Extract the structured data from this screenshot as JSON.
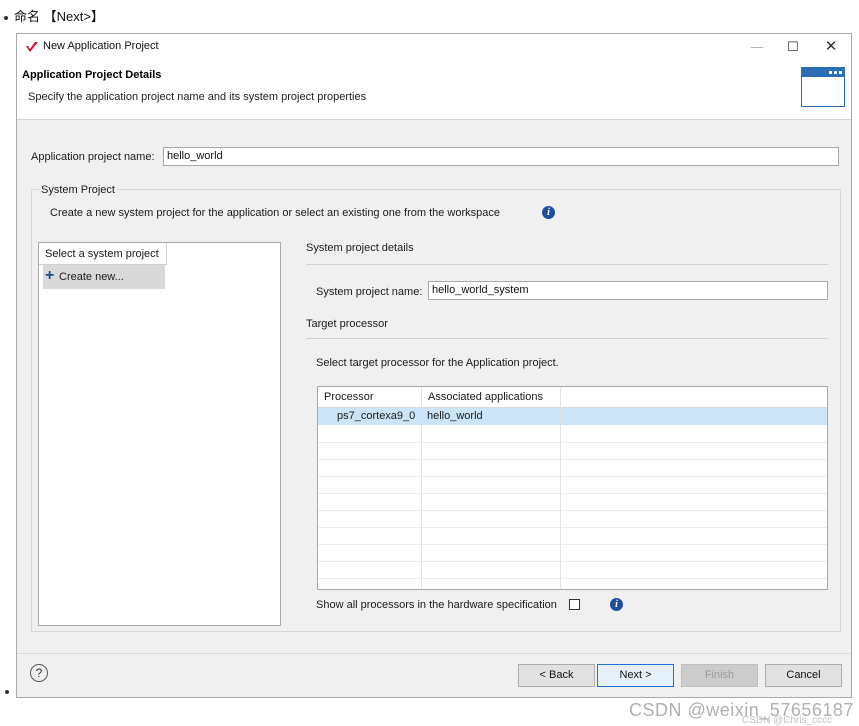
{
  "caption": {
    "text": "命名 【Next>】"
  },
  "window": {
    "title": "New Application Project",
    "controls": {
      "minimize": "—",
      "maximize": "☐",
      "close": "✕"
    }
  },
  "header": {
    "title": "Application Project Details",
    "subtitle": "Specify the application project name and its system project properties"
  },
  "app_project": {
    "label": "Application project name:",
    "value": "hello_world"
  },
  "system_project": {
    "group_label": "System Project",
    "description": "Create a new system project for the application or select an existing one from the workspace",
    "list": {
      "header": "Select a system project",
      "items": [
        {
          "label": "Create new...",
          "selected": true
        }
      ]
    },
    "details": {
      "section_title": "System project details",
      "name_label": "System project name:",
      "name_value": "hello_world_system",
      "target_title": "Target processor",
      "select_text": "Select target processor for the Application project.",
      "table": {
        "columns": [
          "Processor",
          "Associated applications"
        ],
        "rows": [
          {
            "processor": "ps7_cortexa9_0",
            "apps": "hello_world",
            "selected": true
          }
        ]
      },
      "show_all_label": "Show all processors in the hardware specification",
      "show_all_checked": false
    }
  },
  "footer": {
    "help": "?",
    "back": "< Back",
    "next": "Next >",
    "finish": "Finish",
    "cancel": "Cancel"
  },
  "watermark": {
    "main": "CSDN @weixin_57656187",
    "secondary": "CSDN @Chris_cccc"
  },
  "colors": {
    "accent": "#1e73d8",
    "selection": "#cce4f7",
    "icon_blue": "#1f4e9c",
    "logo_red": "#c8102e"
  }
}
